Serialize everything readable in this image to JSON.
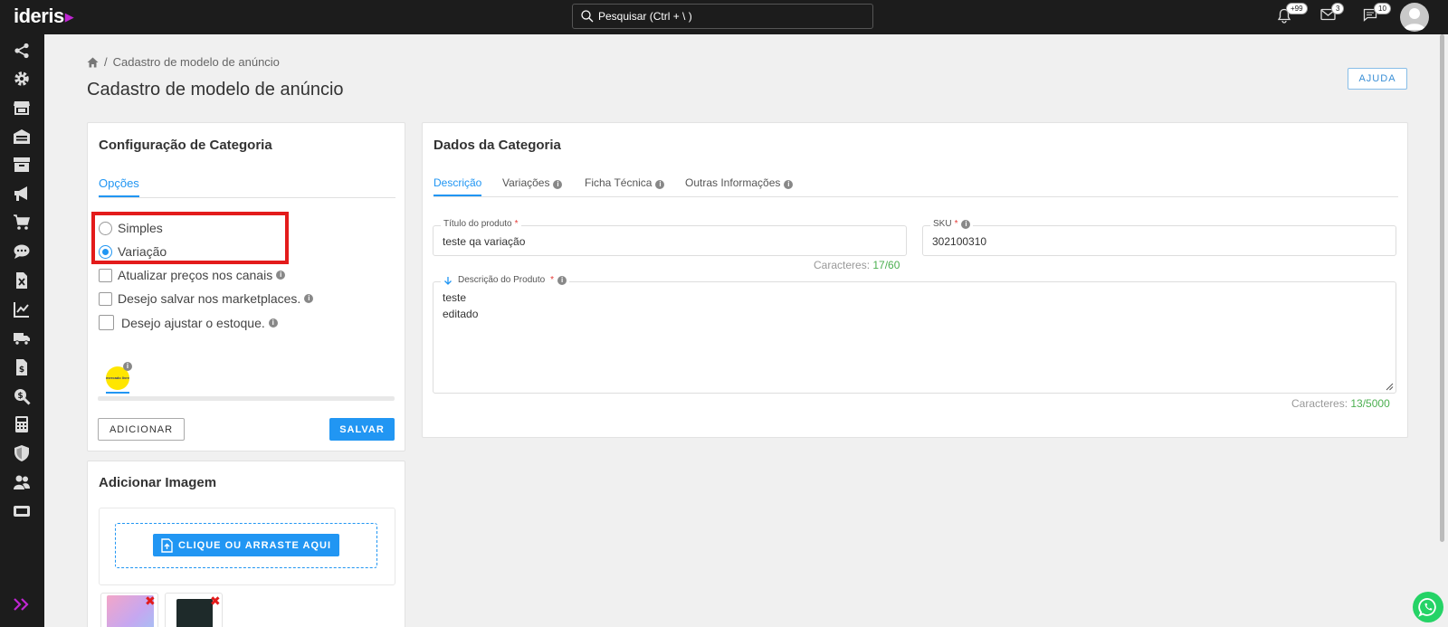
{
  "header": {
    "logo": "ideris",
    "search_placeholder": "Pesquisar (Ctrl + \\ )",
    "notifications_badge": "+99",
    "mail_badge": "3",
    "messages_badge": "10"
  },
  "sidebar": {
    "icons": [
      "share-icon",
      "gear-icon",
      "store-icon",
      "warehouse-icon",
      "archive-icon",
      "megaphone-icon",
      "cart-icon",
      "chat-icon",
      "excel-file-icon",
      "chart-icon",
      "truck-icon",
      "invoice-icon",
      "search-money-icon",
      "calculator-icon",
      "shield-icon",
      "users-icon",
      "ticket-icon"
    ],
    "expand_icon": "double-chevron-right-icon"
  },
  "breadcrumb": {
    "current": "Cadastro de modelo de anúncio"
  },
  "page_title": "Cadastro de modelo de anúncio",
  "help_button": "AJUDA",
  "config_card": {
    "title": "Configuração de Categoria",
    "tab": "Opções",
    "radio_simple": "Simples",
    "radio_variation": "Variação",
    "selected": "Variação",
    "check_update_prices": "Atualizar preços nos canais",
    "check_save_marketplaces": "Desejo salvar nos marketplaces.",
    "check_adjust_stock": "Desejo ajustar o estoque.",
    "marketplace_logo_text": "mercado livre",
    "add_button": "ADICIONAR",
    "save_button": "SALVAR"
  },
  "image_card": {
    "title": "Adicionar Imagem",
    "upload_button": "CLIQUE OU ARRASTE AQUI"
  },
  "data_card": {
    "title": "Dados da Categoria",
    "tabs": [
      "Descrição",
      "Variações",
      "Ficha Técnica",
      "Outras Informações"
    ],
    "active_tab": "Descrição",
    "title_label": "Título do produto",
    "title_value": "teste qa variação",
    "title_counter_label": "Caracteres:",
    "title_counter_value": "17/60",
    "sku_label": "SKU",
    "sku_value": "302100310",
    "desc_label": "Descrição do Produto",
    "desc_line1": "teste",
    "desc_line2": "editado",
    "desc_counter_label": "Caracteres:",
    "desc_counter_value": "13/5000"
  },
  "colors": {
    "accent": "#2196f3",
    "highlight": "#e31b1b",
    "topbar": "#1c1c1c",
    "success": "#4caf50"
  }
}
